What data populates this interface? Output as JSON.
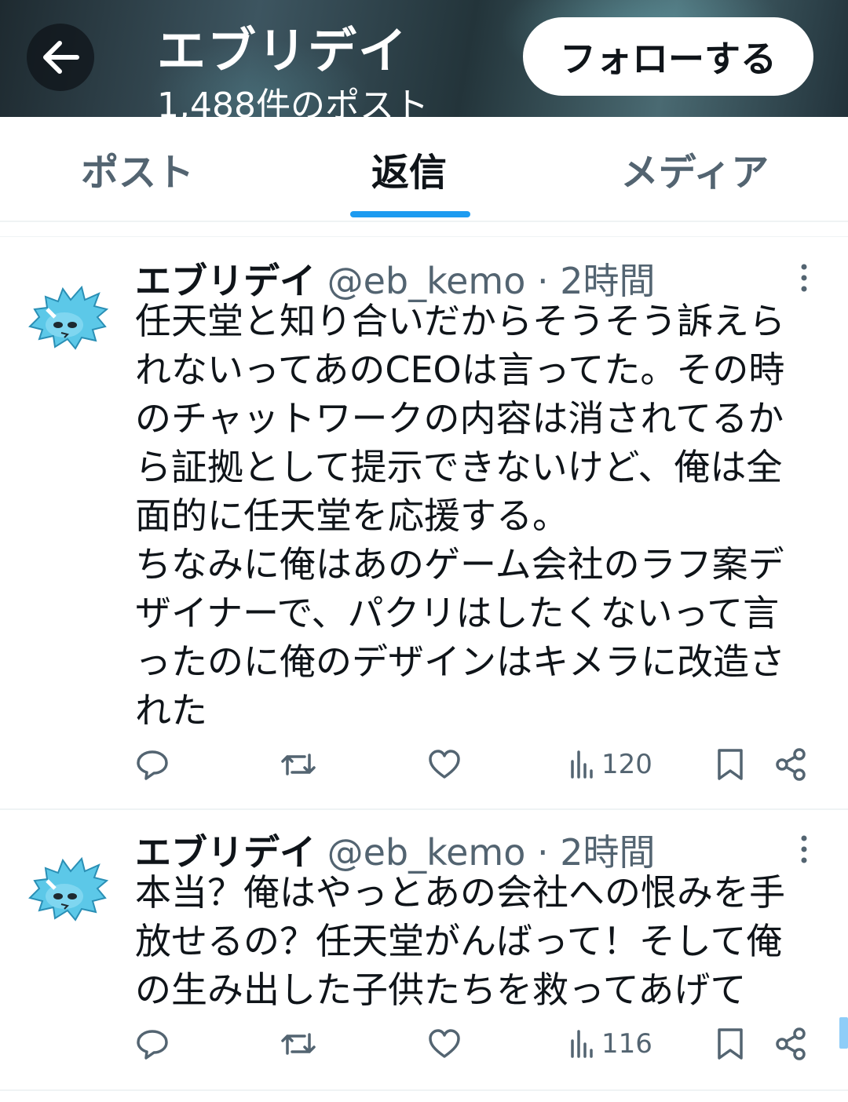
{
  "header": {
    "title": "エブリデイ",
    "subtitle": "1,488件のポスト",
    "follow_label": "フォローする"
  },
  "tabs": [
    {
      "label": "ポスト"
    },
    {
      "label": "返信"
    },
    {
      "label": "メディア"
    }
  ],
  "posts": [
    {
      "name": "エブリデイ",
      "meta": "@eb_kemo · 2時間",
      "text": "任天堂と知り合いだからそうそう訴えら\nれないってあのCEOは言ってた。その時\nのチャットワークの内容は消されてるか\nら証拠として提示できないけど、俺は全\n面的に任天堂を応援する。\nちなみに俺はあのゲーム会社のラフ案デ\nザイナーで、パクリはしたくないって言\nったのに俺のデザインはキメラに改造さ\nれた",
      "views": "120"
    },
    {
      "name": "エブリデイ",
      "meta": "@eb_kemo · 2時間",
      "text": "本当？俺はやっとあの会社への恨みを手\n放せるの？任天堂がんばって！そして俺\nの生み出した子供たちを救ってあげて",
      "views": "116"
    }
  ],
  "icons": {
    "reply": "reply-icon",
    "repost": "repost-icon",
    "like": "heart-icon",
    "views": "views-icon",
    "bookmark": "bookmark-icon",
    "share": "share-icon"
  },
  "colors": {
    "accent": "#1d9bf0",
    "secondary_text": "#536471",
    "avatar_fill": "#5cc8e8"
  }
}
